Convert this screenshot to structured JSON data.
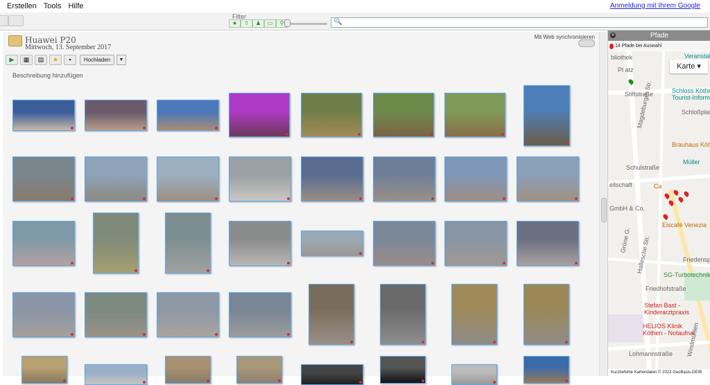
{
  "menu": [
    "Erstellen",
    "Tools",
    "Hilfe"
  ],
  "signin": "Anmeldung mit Ihrem Google",
  "filter": {
    "label": "Filter",
    "buttons": [
      "★",
      "⇧",
      "♟",
      "▭",
      "⚲"
    ]
  },
  "search": {
    "placeholder": ""
  },
  "album": {
    "title": "Huawei P20",
    "date": "Mittwoch, 13. September 2017",
    "sync_label": "Mit Web synchronisieren",
    "upload_label": "Hochladen",
    "caption_placeholder": "Beschreibung hinzufügen"
  },
  "colors": {
    "thumb_border": "#5aa8e8",
    "panel_header": "#8a8a8a",
    "map_bg": "#f1f0ec"
  },
  "photos": [
    {
      "c1": "#3b5d9a",
      "c2": "#c7b9a8"
    },
    {
      "c1": "#6a5a6a",
      "c2": "#b89c8c"
    },
    {
      "c1": "#4c77b8",
      "c2": "#a58e76"
    },
    {
      "c1": "#b03ac8",
      "c2": "#6b3a5a"
    },
    {
      "c1": "#6f7e48",
      "c2": "#a38a58"
    },
    {
      "c1": "#6d8a4a",
      "c2": "#7a6346"
    },
    {
      "c1": "#7f9a58",
      "c2": "#8b6e48"
    },
    {
      "c1": "#4f7fb8",
      "c2": "#6a5d4a"
    },
    {
      "c1": "#7a868c",
      "c2": "#8a7a6c"
    },
    {
      "c1": "#8ea3b8",
      "c2": "#8d8a82"
    },
    {
      "c1": "#9cb0c0",
      "c2": "#9d8f84"
    },
    {
      "c1": "#9aa0a4",
      "c2": "#c8c6c4"
    },
    {
      "c1": "#5a6c90",
      "c2": "#9a8e84"
    },
    {
      "c1": "#6e7e98",
      "c2": "#9a9088"
    },
    {
      "c1": "#7f97b8",
      "c2": "#9d8e84"
    },
    {
      "c1": "#8aa0b8",
      "c2": "#a09080"
    },
    {
      "c1": "#7e9aa8",
      "c2": "#b3a0a0"
    },
    {
      "c1": "#7f8a7a",
      "c2": "#a4a070"
    },
    {
      "c1": "#7d8e90",
      "c2": "#9fa2a0"
    },
    {
      "c1": "#8a8c8c",
      "c2": "#b9b7b5"
    },
    {
      "c1": "#9aa8b4",
      "c2": "#a09690"
    },
    {
      "c1": "#7a8898",
      "c2": "#9a8c88"
    },
    {
      "c1": "#8896a4",
      "c2": "#a29894"
    },
    {
      "c1": "#6b7080",
      "c2": "#a8a0a0"
    },
    {
      "c1": "#8a96a8",
      "c2": "#a6a09a"
    },
    {
      "c1": "#7c8a80",
      "c2": "#9a9288"
    },
    {
      "c1": "#8d98a4",
      "c2": "#aaa4a0"
    },
    {
      "c1": "#788696",
      "c2": "#9c9c9c"
    },
    {
      "c1": "#7a6c5c",
      "c2": "#9a9088"
    },
    {
      "c1": "#6a6a6a",
      "c2": "#8e8e8e"
    },
    {
      "c1": "#a08a5a",
      "c2": "#8e8c88"
    },
    {
      "c1": "#9a8856",
      "c2": "#908c86"
    },
    {
      "c1": "#b8a070",
      "c2": "#8a7a60"
    },
    {
      "c1": "#9ab0c8",
      "c2": "#c8c4c0"
    },
    {
      "c1": "#a89070",
      "c2": "#8a7c6a"
    },
    {
      "c1": "#a89878",
      "c2": "#908070"
    },
    {
      "c1": "#444",
      "c2": "#222"
    },
    {
      "c1": "#555",
      "c2": "#111"
    },
    {
      "c1": "#bbb",
      "c2": "#999"
    },
    {
      "c1": "#3a6aa8",
      "c2": "#9a7a58"
    }
  ],
  "panel": {
    "title": "Pfade",
    "info": "14 Pfade bei Auswahl",
    "map_type": "Karte",
    "footer": "Kurzbefehle   Kartendaten © 2023 GeoBasis-DE/B"
  },
  "map_labels": [
    "bliothek",
    "Pl   atz",
    "Stiftstraße",
    "Schloss Köthen",
    "Tourist-Inform",
    "Schloßplatz",
    "Magdeburger Str.",
    "Brauhaus Köthen",
    "Schulstraße",
    "Müller",
    "ellschaft",
    "Ca",
    "GmbH & Co.",
    "Eiscafé Venezia",
    "Grüne G.",
    "Hallesche Str.",
    "Friedensp",
    "SG-Turbotechnik",
    "Friedhofstraße",
    "Stefan Bast -",
    "Kinderarztpraxis",
    "HELIOS Klinik",
    "Köthen - Notaufnal",
    "Lohmannstraße",
    "Windmühlen",
    "Veranstalt"
  ]
}
